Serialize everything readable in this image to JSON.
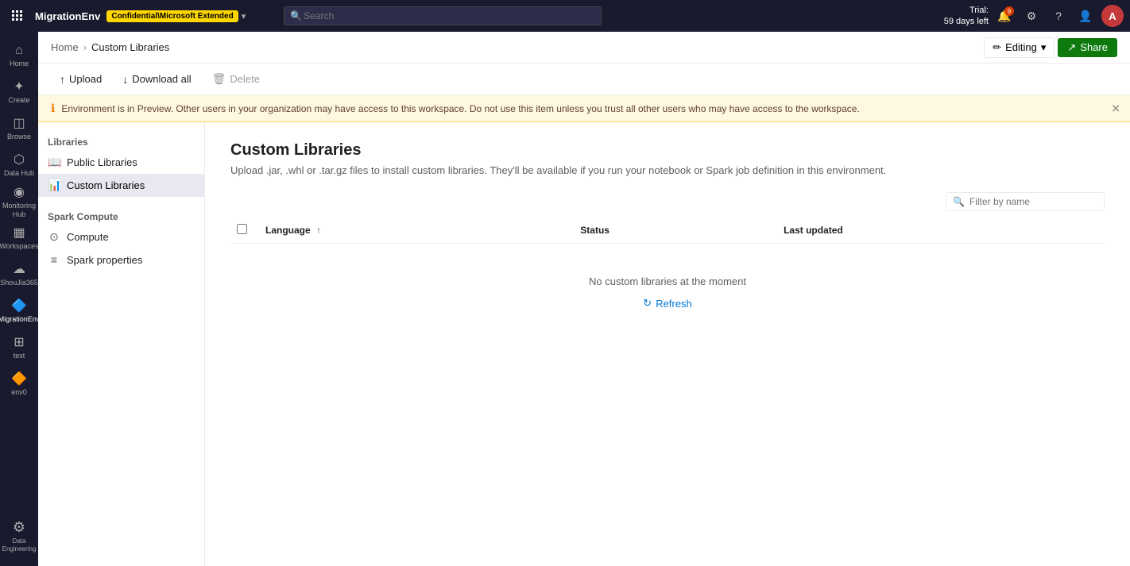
{
  "topbar": {
    "grid_icon": "⊞",
    "app_name": "MigrationEnv",
    "badge": "Confidential\\Microsoft Extended",
    "dropdown_icon": "▾",
    "search_placeholder": "Search",
    "trial_line1": "Trial:",
    "trial_line2": "59 days left",
    "notification_count": "9",
    "settings_icon": "⚙",
    "help_icon": "?",
    "people_icon": "👤",
    "avatar_initial": "A"
  },
  "leftnav": {
    "items": [
      {
        "id": "home",
        "icon": "⌂",
        "label": "Home"
      },
      {
        "id": "create",
        "icon": "✦",
        "label": "Create"
      },
      {
        "id": "browse",
        "icon": "◫",
        "label": "Browse"
      },
      {
        "id": "datahub",
        "icon": "⬡",
        "label": "Data Hub"
      },
      {
        "id": "monitoring",
        "icon": "◉",
        "label": "Monitoring Hub"
      },
      {
        "id": "workspaces",
        "icon": "▦",
        "label": "Workspaces"
      },
      {
        "id": "shoujia365",
        "icon": "☁",
        "label": "ShouJia365"
      },
      {
        "id": "migrationenv",
        "icon": "🔷",
        "label": "MigrationEnv",
        "active": true
      },
      {
        "id": "test",
        "icon": "⊞",
        "label": "test"
      },
      {
        "id": "env0",
        "icon": "🔶",
        "label": "env0"
      }
    ],
    "bottom_item": {
      "id": "data-engineering",
      "icon": "⚙",
      "label": "Data Engineering"
    }
  },
  "breadcrumb": {
    "home_label": "Home",
    "current_label": "Custom Libraries"
  },
  "toolbar": {
    "upload_label": "Upload",
    "upload_icon": "↑",
    "download_all_label": "Download all",
    "download_icon": "↓",
    "delete_label": "Delete",
    "delete_icon": "🗑",
    "edit_label": "Editing",
    "edit_icon": "✏",
    "share_label": "Share",
    "share_icon": "↗"
  },
  "warning_banner": {
    "icon": "ℹ",
    "text": "Environment is in Preview. Other users in your organization may have access to this workspace. Do not use this item unless you trust all other users who may have access to the workspace."
  },
  "sidebar": {
    "libraries_section": "Libraries",
    "public_libraries_label": "Public Libraries",
    "public_libraries_icon": "📖",
    "custom_libraries_label": "Custom Libraries",
    "custom_libraries_icon": "📊",
    "spark_compute_section": "Spark Compute",
    "compute_label": "Compute",
    "compute_icon": "⊙",
    "spark_properties_label": "Spark properties",
    "spark_properties_icon": "≡"
  },
  "main": {
    "page_title": "Custom Libraries",
    "page_desc": "Upload .jar, .whl or .tar.gz files to install custom libraries. They'll be available if you run your notebook or Spark job definition in this environment.",
    "filter_placeholder": "Filter by name",
    "table": {
      "columns": [
        {
          "id": "language",
          "label": "Language",
          "sortable": true,
          "sort_icon": "↑"
        },
        {
          "id": "status",
          "label": "Status",
          "sortable": false
        },
        {
          "id": "last_updated",
          "label": "Last updated",
          "sortable": false
        }
      ],
      "empty_text": "No custom libraries at the moment",
      "refresh_label": "Refresh",
      "refresh_icon": "↻"
    }
  }
}
